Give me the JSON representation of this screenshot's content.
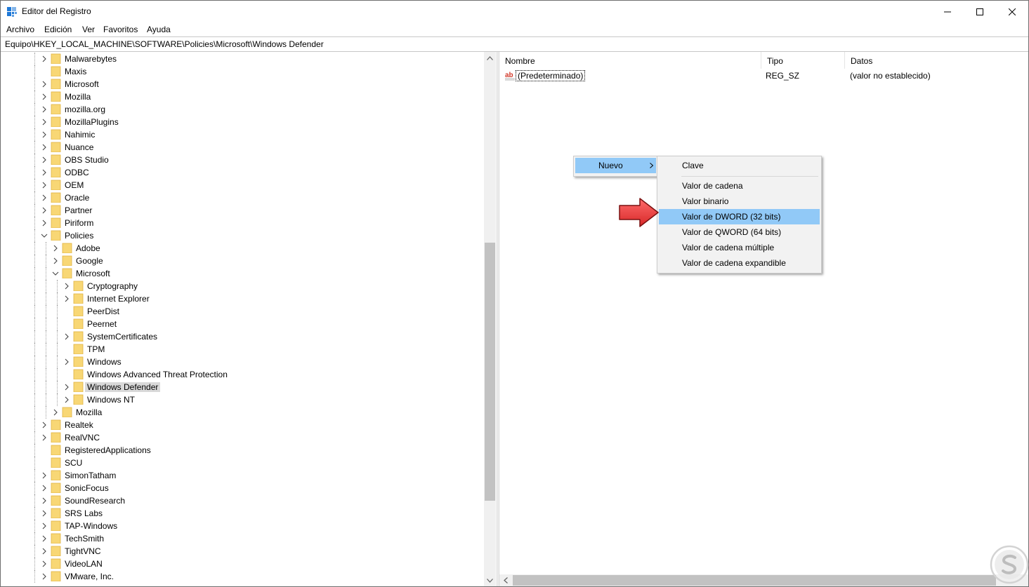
{
  "window": {
    "title": "Editor del Registro"
  },
  "menu": [
    "Archivo",
    "Edición",
    "Ver",
    "Favoritos",
    "Ayuda"
  ],
  "address": "Equipo\\HKEY_LOCAL_MACHINE\\SOFTWARE\\Policies\\Microsoft\\Windows Defender",
  "tree": {
    "items": [
      {
        "label": "Malwarebytes",
        "level": 0,
        "expand": "collapsed"
      },
      {
        "label": "Maxis",
        "level": 0,
        "expand": "none"
      },
      {
        "label": "Microsoft",
        "level": 0,
        "expand": "collapsed"
      },
      {
        "label": "Mozilla",
        "level": 0,
        "expand": "collapsed"
      },
      {
        "label": "mozilla.org",
        "level": 0,
        "expand": "collapsed"
      },
      {
        "label": "MozillaPlugins",
        "level": 0,
        "expand": "collapsed"
      },
      {
        "label": "Nahimic",
        "level": 0,
        "expand": "collapsed"
      },
      {
        "label": "Nuance",
        "level": 0,
        "expand": "collapsed"
      },
      {
        "label": "OBS Studio",
        "level": 0,
        "expand": "collapsed"
      },
      {
        "label": "ODBC",
        "level": 0,
        "expand": "collapsed"
      },
      {
        "label": "OEM",
        "level": 0,
        "expand": "collapsed"
      },
      {
        "label": "Oracle",
        "level": 0,
        "expand": "collapsed"
      },
      {
        "label": "Partner",
        "level": 0,
        "expand": "collapsed"
      },
      {
        "label": "Piriform",
        "level": 0,
        "expand": "collapsed"
      },
      {
        "label": "Policies",
        "level": 0,
        "expand": "expanded"
      },
      {
        "label": "Adobe",
        "level": 1,
        "expand": "collapsed"
      },
      {
        "label": "Google",
        "level": 1,
        "expand": "collapsed"
      },
      {
        "label": "Microsoft",
        "level": 1,
        "expand": "expanded"
      },
      {
        "label": "Cryptography",
        "level": 2,
        "expand": "collapsed"
      },
      {
        "label": "Internet Explorer",
        "level": 2,
        "expand": "collapsed"
      },
      {
        "label": "PeerDist",
        "level": 2,
        "expand": "none"
      },
      {
        "label": "Peernet",
        "level": 2,
        "expand": "none"
      },
      {
        "label": "SystemCertificates",
        "level": 2,
        "expand": "collapsed"
      },
      {
        "label": "TPM",
        "level": 2,
        "expand": "none"
      },
      {
        "label": "Windows",
        "level": 2,
        "expand": "collapsed"
      },
      {
        "label": "Windows Advanced Threat Protection",
        "level": 2,
        "expand": "none"
      },
      {
        "label": "Windows Defender",
        "level": 2,
        "expand": "collapsed",
        "selected": true
      },
      {
        "label": "Windows NT",
        "level": 2,
        "expand": "collapsed"
      },
      {
        "label": "Mozilla",
        "level": 1,
        "expand": "collapsed"
      },
      {
        "label": "Realtek",
        "level": 0,
        "expand": "collapsed"
      },
      {
        "label": "RealVNC",
        "level": 0,
        "expand": "collapsed"
      },
      {
        "label": "RegisteredApplications",
        "level": 0,
        "expand": "none"
      },
      {
        "label": "SCU",
        "level": 0,
        "expand": "none"
      },
      {
        "label": "SimonTatham",
        "level": 0,
        "expand": "collapsed"
      },
      {
        "label": "SonicFocus",
        "level": 0,
        "expand": "collapsed"
      },
      {
        "label": "SoundResearch",
        "level": 0,
        "expand": "collapsed"
      },
      {
        "label": "SRS Labs",
        "level": 0,
        "expand": "collapsed"
      },
      {
        "label": "TAP-Windows",
        "level": 0,
        "expand": "collapsed"
      },
      {
        "label": "TechSmith",
        "level": 0,
        "expand": "collapsed"
      },
      {
        "label": "TightVNC",
        "level": 0,
        "expand": "collapsed"
      },
      {
        "label": "VideoLAN",
        "level": 0,
        "expand": "collapsed"
      },
      {
        "label": "VMware, Inc.",
        "level": 0,
        "expand": "collapsed"
      }
    ]
  },
  "list": {
    "columns": [
      "Nombre",
      "Tipo",
      "Datos"
    ],
    "rows": [
      {
        "name": "(Predeterminado)",
        "type": "REG_SZ",
        "data": "(valor no establecido)",
        "icon": "string-value-icon"
      }
    ]
  },
  "context_menu": {
    "parent": {
      "label": "Nuevo"
    },
    "submenu": {
      "first": "Clave",
      "items": [
        "Valor de cadena",
        "Valor binario",
        "Valor de DWORD (32 bits)",
        "Valor de QWORD (64 bits)",
        "Valor de cadena múltiple",
        "Valor de cadena expandible"
      ],
      "highlighted_index": 2
    }
  },
  "colors": {
    "highlight": "#91c9f7",
    "selection_gray": "#d9d9d9",
    "folder": "#f8d775",
    "folder_edge": "#e0b342",
    "arrow": "#e63b3b"
  },
  "icons": {
    "app": "registry-editor-icon",
    "annotation": "red-arrow-icon",
    "watermark": "logo-watermark-icon"
  }
}
